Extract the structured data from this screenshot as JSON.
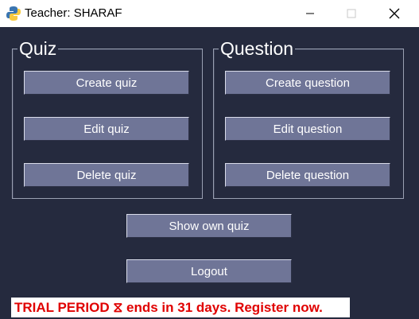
{
  "window": {
    "title": "Teacher: SHARAF",
    "app_icon": "python-icon",
    "min_icon": "minimize-icon",
    "max_icon": "maximize-icon",
    "close_icon": "close-icon"
  },
  "quiz_group": {
    "title": "Quiz",
    "buttons": [
      "Create quiz",
      "Edit quiz",
      "Delete quiz"
    ]
  },
  "question_group": {
    "title": "Question",
    "buttons": [
      "Create question",
      "Edit question",
      "Delete question"
    ]
  },
  "main_buttons": {
    "show_own_quiz": "Show own quiz",
    "logout": "Logout"
  },
  "trial_banner": "TRIAL PERIOD ⧖ ends in 31 days. Register now.",
  "colors": {
    "background": "#252a3e",
    "button": "#6f7597",
    "trial_text": "#e00000"
  }
}
